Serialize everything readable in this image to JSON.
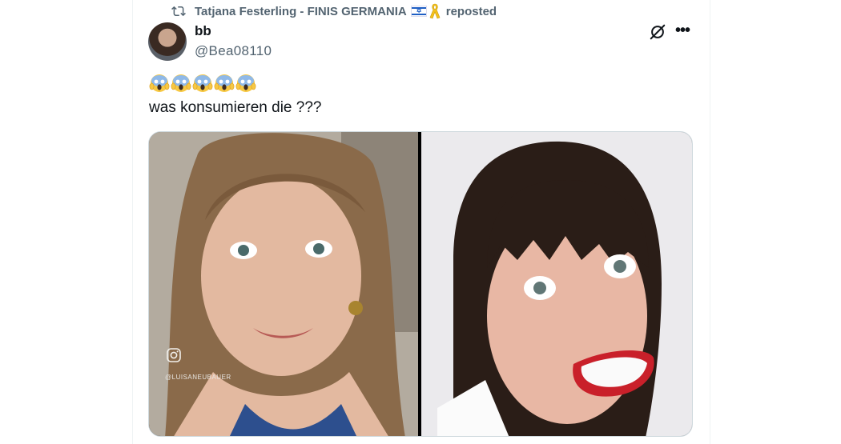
{
  "repost": {
    "user": "Tatjana Festerling - FINIS GERMANIA",
    "suffix": "reposted",
    "icon": "repost-icon",
    "flag_icon": "israel-flag-icon",
    "ribbon_icon": "yellow-ribbon-icon"
  },
  "post": {
    "author_name": "bb",
    "author_handle": "@Bea08110",
    "emojis": [
      "😱",
      "😱",
      "😱",
      "😱",
      "😱"
    ],
    "text": "was konsumieren die ???",
    "more_label": "•••",
    "grok_icon": "grok-icon"
  },
  "media": {
    "left_image": "photo-woman-wide-eyes",
    "left_overlay_handle": "@LUISANEUBAUER",
    "right_image": "photo-woman-grimace"
  }
}
